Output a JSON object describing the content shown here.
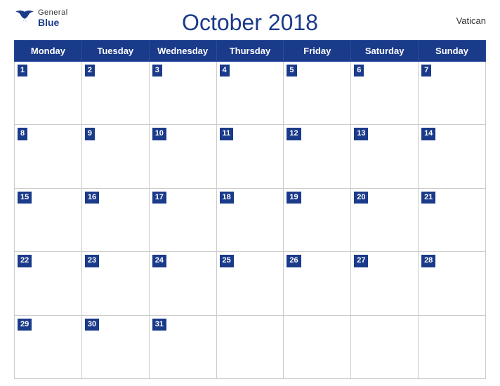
{
  "header": {
    "logo_general": "General",
    "logo_blue": "Blue",
    "title": "October 2018",
    "country": "Vatican"
  },
  "weekdays": [
    "Monday",
    "Tuesday",
    "Wednesday",
    "Thursday",
    "Friday",
    "Saturday",
    "Sunday"
  ],
  "weeks": [
    [
      1,
      2,
      3,
      4,
      5,
      6,
      7
    ],
    [
      8,
      9,
      10,
      11,
      12,
      13,
      14
    ],
    [
      15,
      16,
      17,
      18,
      19,
      20,
      21
    ],
    [
      22,
      23,
      24,
      25,
      26,
      27,
      28
    ],
    [
      29,
      30,
      31,
      null,
      null,
      null,
      null
    ]
  ]
}
